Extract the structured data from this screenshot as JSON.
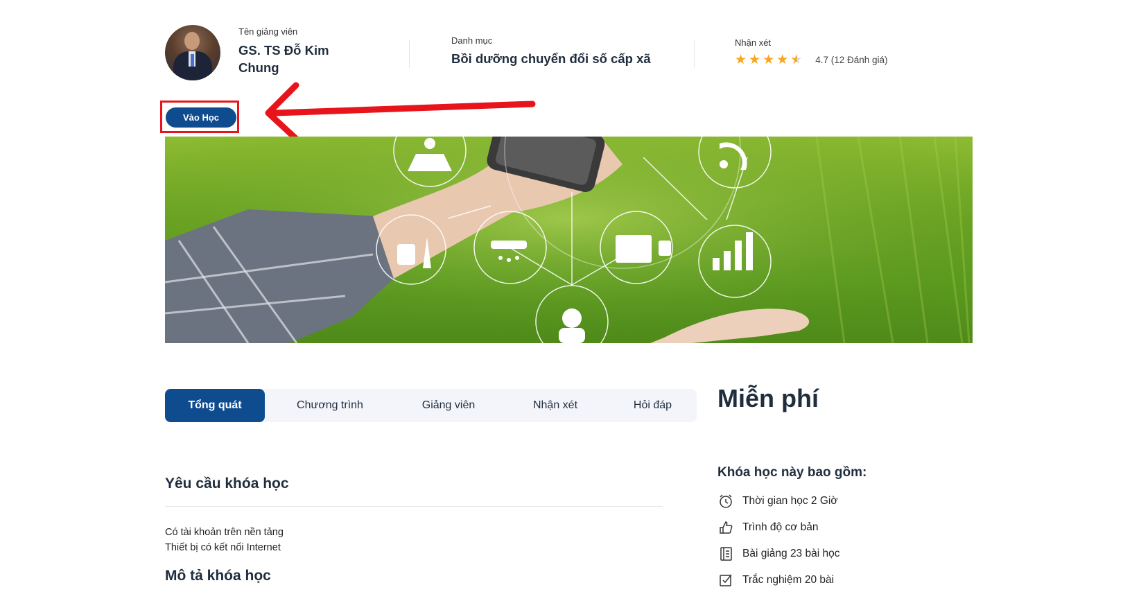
{
  "instructor": {
    "label": "Tên giảng viên",
    "name": "GS. TS Đỗ Kim Chung"
  },
  "category": {
    "label": "Danh mục",
    "name": "Bồi dưỡng chuyển đổi số cấp xã"
  },
  "review": {
    "label": "Nhận xét",
    "rating": 4.7,
    "rating_text": "4.7 (12 Đánh giá)",
    "stars_max": 5
  },
  "enter_button": {
    "label": "Vào Học"
  },
  "colors": {
    "primary": "#0f4c8f",
    "highlight": "#e8141b",
    "star": "#f5a623"
  },
  "tabs": [
    {
      "label": "Tổng quát",
      "active": true
    },
    {
      "label": "Chương trình",
      "active": false
    },
    {
      "label": "Giảng viên",
      "active": false
    },
    {
      "label": "Nhận xét",
      "active": false
    },
    {
      "label": "Hỏi đáp",
      "active": false
    }
  ],
  "price": "Miễn phí",
  "requirements": {
    "title": "Yêu cầu khóa học",
    "items": [
      "Có tài khoản trên nền tảng",
      "Thiết bị có kết nối Internet"
    ]
  },
  "description": {
    "title": "Mô tả khóa học"
  },
  "includes": {
    "title": "Khóa học này bao gồm:",
    "items": [
      {
        "icon": "alarm-clock-icon",
        "text": "Thời gian học 2 Giờ"
      },
      {
        "icon": "thumb-up-icon",
        "text": "Trình độ cơ bản"
      },
      {
        "icon": "notebook-icon",
        "text": "Bài giảng 23 bài học"
      },
      {
        "icon": "checkbox-icon",
        "text": "Trắc nghiệm 20 bài"
      }
    ]
  }
}
